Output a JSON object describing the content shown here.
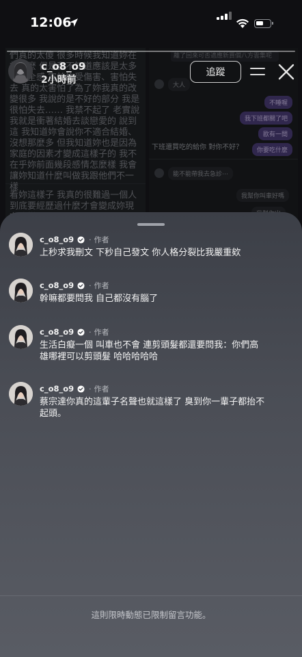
{
  "status_bar": {
    "time": "12:06"
  },
  "story": {
    "username": "c_o8_o9",
    "posted": "2小時前",
    "follow_label": "追蹤",
    "left_panel_text": "們真的太傻 很多時候我知道妳在想什麼 但是我不知道應該是太多不安全感 害怕妳受傷害、害怕失去 真的太害怕了為了妳我真的改變很多 我說的是不好的部分 我是很怕失去…… 我禁不起了 老實說我就是衝著結婚去談戀愛的 說到這 我知道妳會說你不適合結婚、沒想那麼多 但我知道妳也是因為家庭的因素才變成這樣子的 我不在乎妳前面幾段感情怎麼樣 我會讓妳知道什麼叫做我跟他們不一樣",
    "left_panel_text2": "看妳這樣子 我真的很難過一個人到底要經歷過什麼才會變成妳現在這樣",
    "right_notice": "離了回來可否適應新買個八方雲集呢",
    "right_small_left": "大人",
    "right_bubbles": [
      "不睡喔",
      "我下班都關了吧",
      "歐有一間",
      "你要吃什麼"
    ],
    "right_statement": "下班還買吃的給你 對你不好？",
    "right_bottom_left": "能不能帶我去急診⋯",
    "right_bottom_bubbles": [
      "我幫你叫車好嗎",
      "我幫你出"
    ]
  },
  "comments": [
    {
      "username": "c_o8_o9",
      "separator": "·",
      "role": "作者",
      "text": "上秒求我刪文 下秒自己發文 你人格分裂比我嚴重欸"
    },
    {
      "username": "c_o8_o9",
      "separator": "·",
      "role": "作者",
      "text": "幹嘛都要問我 自己都沒有腦了"
    },
    {
      "username": "c_o8_o9",
      "separator": "·",
      "role": "作者",
      "text": "生活白癡一個 叫車也不會 連剪頭髮都還要問我：你們高雄哪裡可以剪頭髮 哈哈哈哈哈"
    },
    {
      "username": "c_o8_o9",
      "separator": "·",
      "role": "作者",
      "text": "蔡宗達你真的這輩子名聲也就這樣了 臭到你一輩子都抬不起頭。"
    }
  ],
  "footer": {
    "notice": "這則限時動態已限制留言功能。"
  },
  "icons": {
    "location": "location-arrow-icon",
    "signal": "cellular-signal-icon",
    "wifi": "wifi-icon",
    "battery": "battery-icon",
    "menu": "menu-icon",
    "close": "close-icon",
    "verified": "verified-badge-icon"
  },
  "colors": {
    "accent_purple": "#4b3c77",
    "sheet_top": "#3c3f47",
    "sheet_bottom": "#595c64"
  }
}
